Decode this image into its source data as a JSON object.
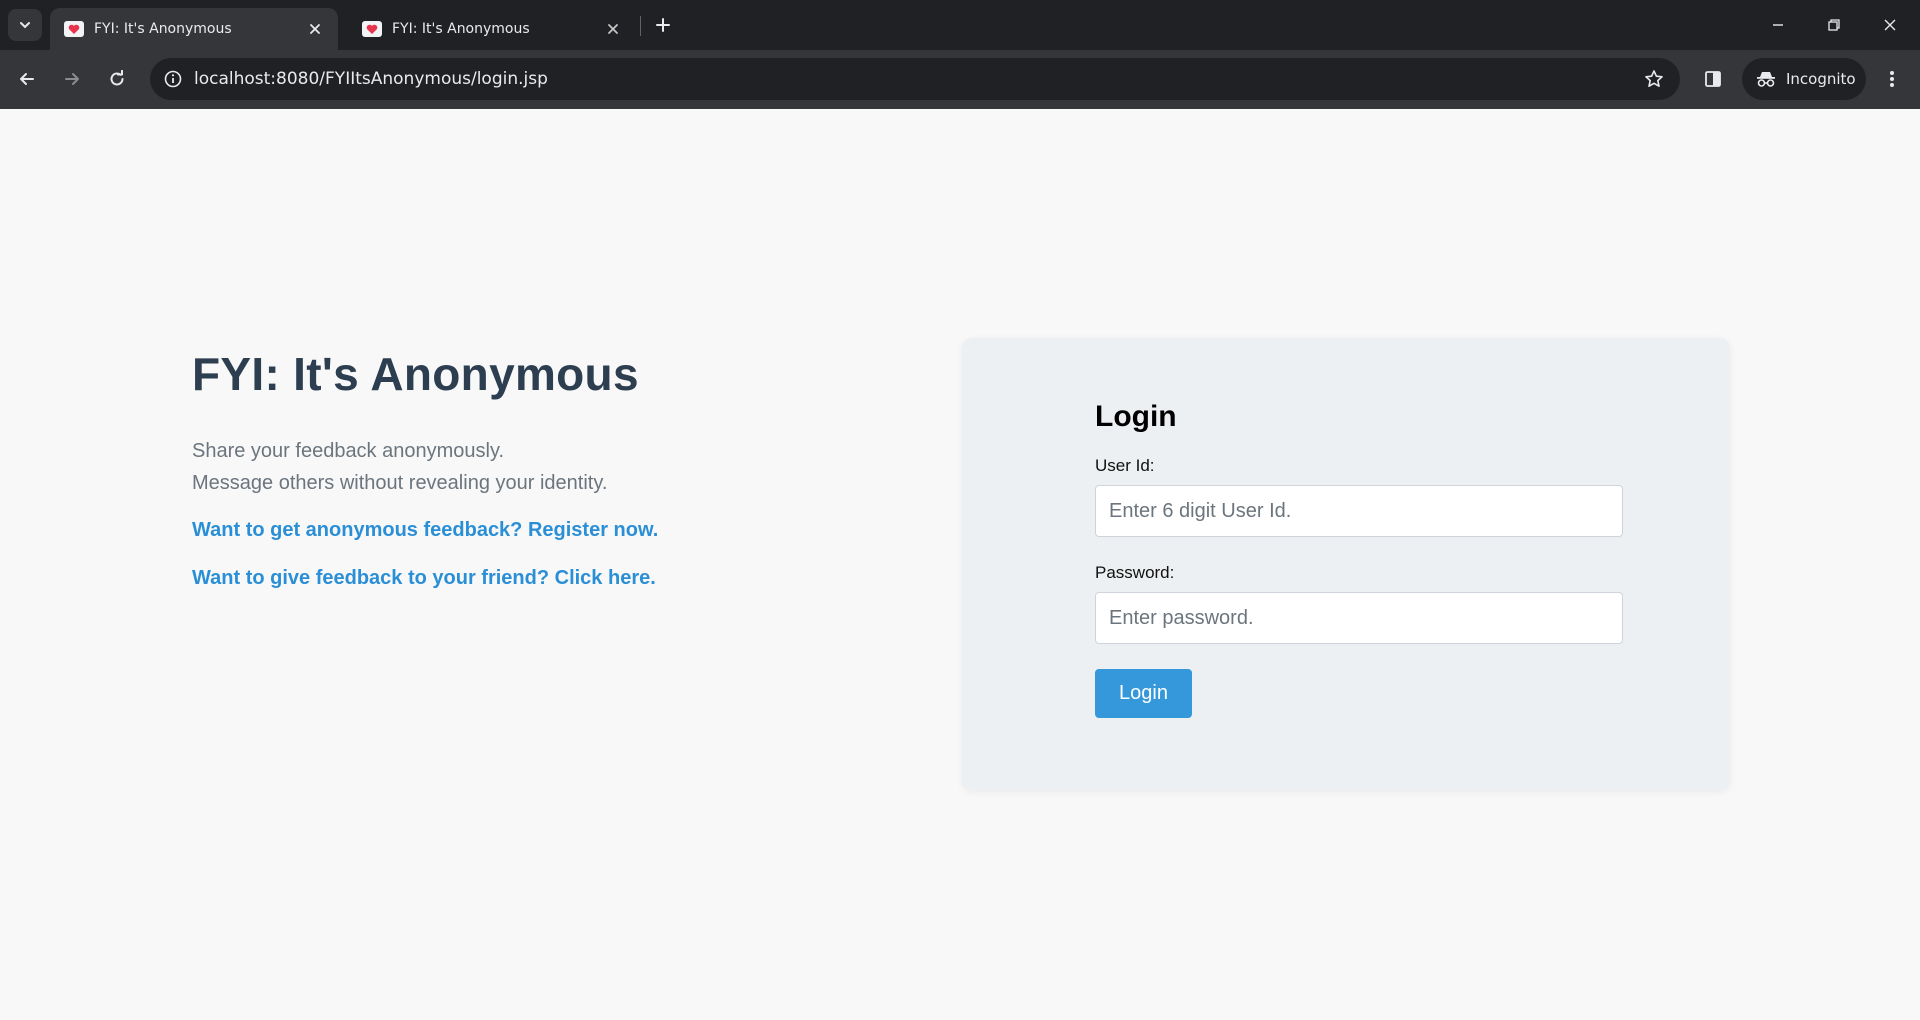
{
  "browser": {
    "tabs": [
      {
        "title": "FYI: It's Anonymous",
        "active": true
      },
      {
        "title": "FYI: It's Anonymous",
        "active": false
      }
    ],
    "url": "localhost:8080/FYIItsAnonymous/login.jsp",
    "incognito_label": "Incognito",
    "colors": {
      "tabbar": "#202124",
      "toolbar": "#35363a",
      "favicon_heart": "#e8344e"
    }
  },
  "hero": {
    "title": "FYI: It's Anonymous",
    "line1": "Share your feedback anonymously.",
    "line2": "Message others without revealing your identity.",
    "register_link": "Want to get anonymous feedback? Register now.",
    "feedback_link": "Want to give feedback to your friend? Click here."
  },
  "login": {
    "heading": "Login",
    "user_label": "User Id:",
    "user_placeholder": "Enter 6 digit User Id.",
    "password_label": "Password:",
    "password_placeholder": "Enter password.",
    "button_label": "Login"
  },
  "colors": {
    "title": "#2c3e50",
    "link": "#2a8fd6",
    "button": "#3498db",
    "card": "#edf0f2",
    "page_bg": "#f8f8f8"
  }
}
